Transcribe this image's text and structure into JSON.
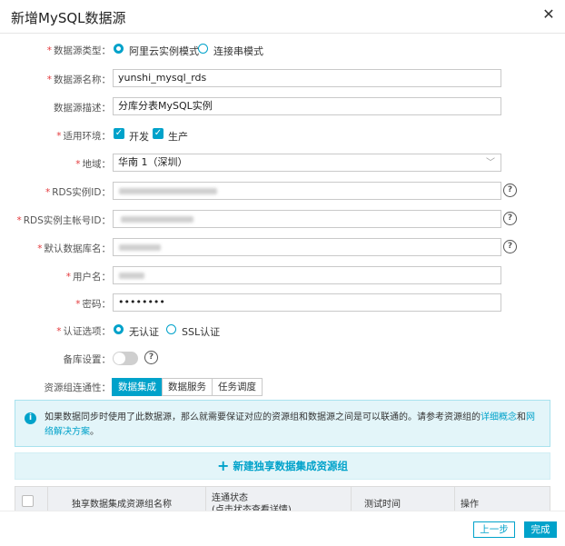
{
  "dialog": {
    "title": "新增MySQL数据源",
    "close_icon": "close-icon"
  },
  "form": {
    "type": {
      "label": "数据源类型：",
      "options": [
        "阿里云实例模式",
        "连接串模式"
      ],
      "selected": 0
    },
    "name": {
      "label": "数据源名称：",
      "value": "yunshi_mysql_rds"
    },
    "desc": {
      "label": "数据源描述：",
      "value": "分库分表MySQL实例"
    },
    "env": {
      "label": "适用环境：",
      "options": [
        "开发",
        "生产"
      ],
      "checked": [
        true,
        true
      ]
    },
    "region": {
      "label": "地域：",
      "value": "华南 1（深圳）"
    },
    "rds_id": {
      "label": "RDS实例ID："
    },
    "rds_owner": {
      "label": "RDS实例主帐号ID："
    },
    "db_name": {
      "label": "默认数据库名："
    },
    "user": {
      "label": "用户名："
    },
    "password": {
      "label": "密码：",
      "value": "••••••••"
    },
    "auth": {
      "label": "认证选项：",
      "options": [
        "无认证",
        "SSL认证"
      ],
      "selected": 0
    },
    "standby": {
      "label": "备库设置：",
      "enabled": false
    },
    "connectivity": {
      "label": "资源组连通性：",
      "tabs": [
        "数据集成",
        "数据服务",
        "任务调度"
      ],
      "active": 0
    }
  },
  "notice": {
    "text_before": "如果数据同步时使用了此数据源，那么就需要保证对应的资源组和数据源之间是可以联通的。请参考资源组的",
    "link1": "详细概念",
    "and": "和",
    "link2": "网络解决方案",
    "end": "。"
  },
  "add_button": {
    "label": "新建独享数据集成资源组"
  },
  "table": {
    "headers": [
      "独享数据集成资源组名称",
      "连通状态",
      "(点击状态查看详情)",
      "测试时间",
      "操作"
    ]
  },
  "footer": {
    "prev_label": "上一步",
    "done_label": "完成"
  },
  "colors": {
    "accent": "#00a2ca",
    "required": "#e4393c",
    "info_bg": "#e3f5f9"
  }
}
